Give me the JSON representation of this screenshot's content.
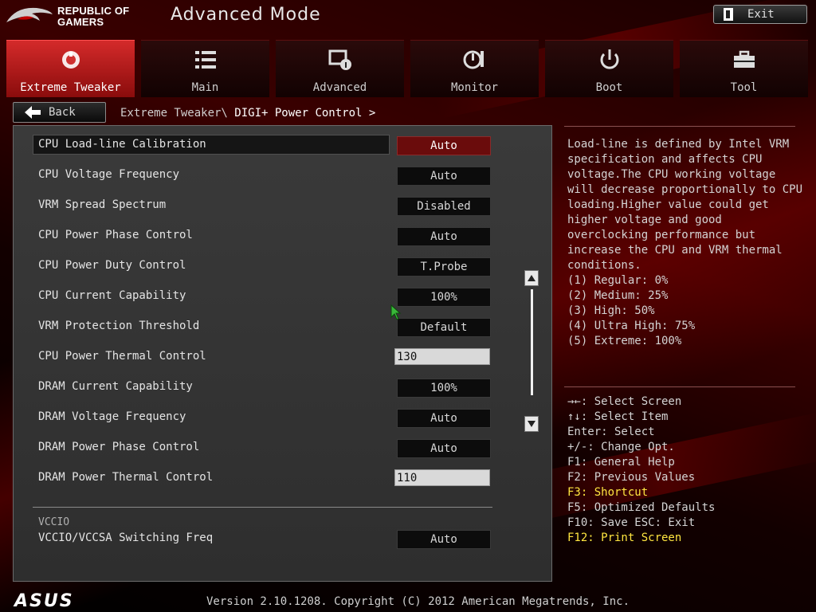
{
  "brand": {
    "line1": "REPUBLIC OF",
    "line2": "GAMERS",
    "accent_color": "#c00000"
  },
  "header": {
    "title": "Advanced Mode",
    "exit_label": "Exit"
  },
  "tabs": [
    {
      "label": "Extreme Tweaker",
      "icon": "extreme-tweaker-icon",
      "active": true
    },
    {
      "label": "Main",
      "icon": "list-icon",
      "active": false
    },
    {
      "label": "Advanced",
      "icon": "advanced-icon",
      "active": false
    },
    {
      "label": "Monitor",
      "icon": "monitor-icon",
      "active": false
    },
    {
      "label": "Boot",
      "icon": "power-icon",
      "active": false
    },
    {
      "label": "Tool",
      "icon": "toolbox-icon",
      "active": false
    }
  ],
  "nav": {
    "back_label": "Back",
    "breadcrumb_path": "Extreme Tweaker\\",
    "breadcrumb_current": "DIGI+ Power Control >"
  },
  "settings": [
    {
      "label": "CPU Load-line Calibration",
      "value": "Auto",
      "selected": true
    },
    {
      "label": "CPU Voltage Frequency",
      "value": "Auto"
    },
    {
      "label": "VRM Spread Spectrum",
      "value": "Disabled"
    },
    {
      "label": "CPU Power Phase Control",
      "value": "Auto"
    },
    {
      "label": "CPU Power Duty Control",
      "value": "T.Probe"
    },
    {
      "label": "CPU Current Capability",
      "value": "100%"
    },
    {
      "label": "VRM Protection Threshold",
      "value": "Default"
    },
    {
      "label": "CPU Power Thermal Control",
      "value": "130",
      "input": true
    },
    {
      "label": "DRAM Current Capability",
      "value": "100%"
    },
    {
      "label": "DRAM Voltage Frequency",
      "value": "Auto"
    },
    {
      "label": "DRAM Power Phase Control",
      "value": "Auto"
    },
    {
      "label": "DRAM Power Thermal Control",
      "value": "110",
      "input": true
    }
  ],
  "section": {
    "header": "VCCIO",
    "item_label": "VCCIO/VCCSA Switching Freq",
    "item_value": "Auto"
  },
  "help": {
    "description": "Load-line is defined by Intel VRM specification and affects CPU voltage.The CPU working voltage will decrease proportionally to CPU loading.Higher value could get higher voltage and good overclocking performance but increase the CPU and VRM thermal conditions.",
    "levels": [
      "(1) Regular: 0%",
      "(2) Medium: 25%",
      "(3) High: 50%",
      "(4) Ultra High: 75%",
      "(5) Extreme: 100%"
    ]
  },
  "keys": [
    {
      "text": "→←: Select Screen",
      "highlight": false
    },
    {
      "text": "↑↓: Select Item",
      "highlight": false
    },
    {
      "text": "Enter: Select",
      "highlight": false
    },
    {
      "text": "+/-: Change Opt.",
      "highlight": false
    },
    {
      "text": "F1: General Help",
      "highlight": false
    },
    {
      "text": "F2: Previous Values",
      "highlight": false
    },
    {
      "text": "F3: Shortcut",
      "highlight": true
    },
    {
      "text": "F5: Optimized Defaults",
      "highlight": false
    },
    {
      "text": "F10: Save  ESC: Exit",
      "highlight": false
    },
    {
      "text": "F12: Print Screen",
      "highlight": true
    }
  ],
  "footer": {
    "logo": "ASUS",
    "version": "Version 2.10.1208. Copyright (C) 2012 American Megatrends, Inc."
  }
}
